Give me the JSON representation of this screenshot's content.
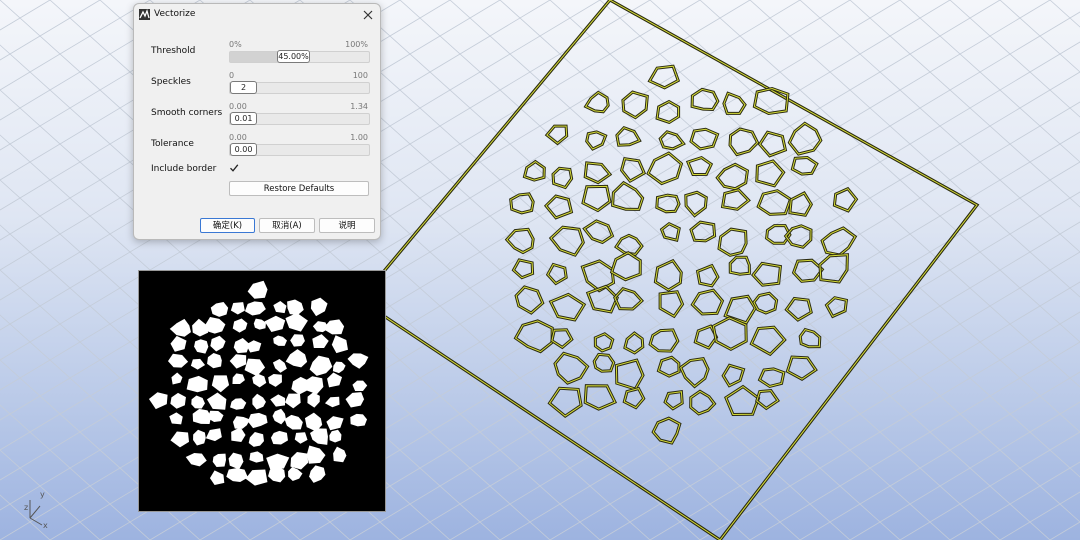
{
  "dialog": {
    "title": "Vectorize",
    "icons": {
      "app": "vectorize-icon",
      "close": "close-icon"
    },
    "threshold": {
      "label": "Threshold",
      "min": "0%",
      "max": "100%",
      "value": "45.00%",
      "fraction": 0.45
    },
    "speckles": {
      "label": "Speckles",
      "min": "0",
      "max": "100",
      "value": "2",
      "fraction": 0.02
    },
    "smooth_corners": {
      "label": "Smooth corners",
      "min": "0.00",
      "max": "1.34",
      "value": "0.01",
      "fraction": 0.007
    },
    "tolerance": {
      "label": "Tolerance",
      "min": "0.00",
      "max": "1.00",
      "value": "0.00",
      "fraction": 0
    },
    "include_border": {
      "label": "Include border",
      "checked": true
    },
    "restore_label": "Restore Defaults",
    "ok_label": "确定(K)",
    "cancel_label": "取消(A)",
    "help_label": "说明"
  },
  "viewport": {
    "axis_labels": {
      "x": "x",
      "y": "y",
      "z": "z"
    },
    "outline_color": "#d6dc3a"
  }
}
